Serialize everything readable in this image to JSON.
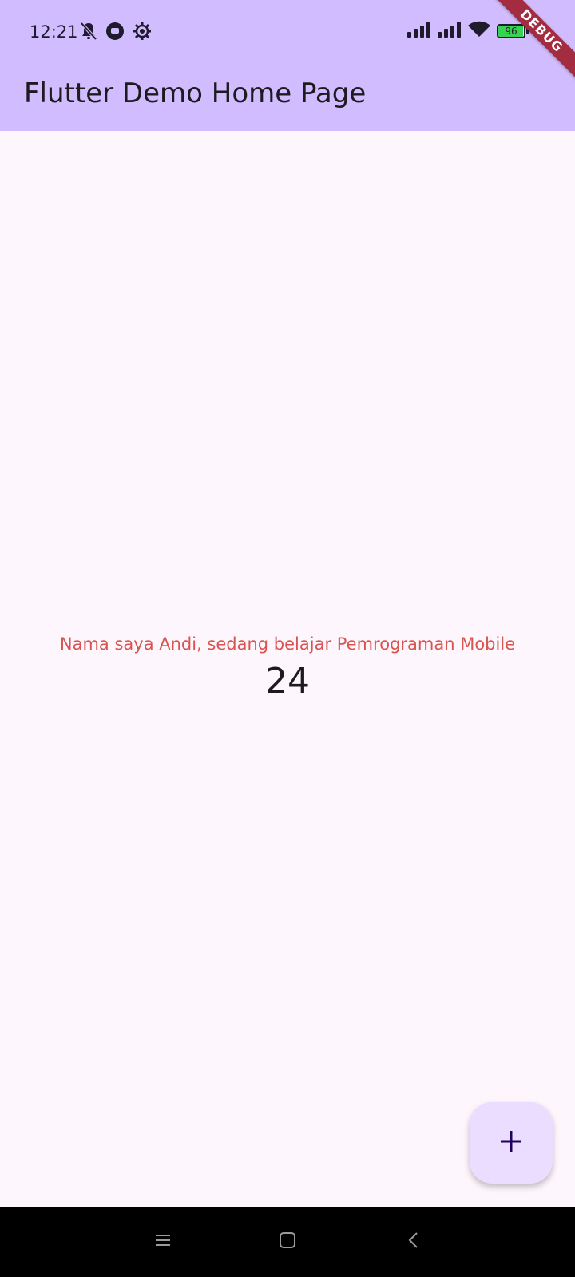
{
  "status_bar": {
    "time": "12:21",
    "battery_level": "96",
    "battery_fraction": 0.96,
    "icons": [
      "bell-off-icon",
      "messenger-icon",
      "gear-icon",
      "signal-icon",
      "signal-icon",
      "wifi-icon",
      "battery-icon"
    ]
  },
  "app_bar": {
    "title": "Flutter Demo Home Page",
    "background_color": "#d0bcff"
  },
  "debug_banner": {
    "label": "DEBUG"
  },
  "main": {
    "message": "Nama saya Andi, sedang belajar Pemrograman Mobile",
    "message_color": "#d9534f",
    "counter": "24"
  },
  "fab": {
    "icon": "plus-icon",
    "background_color": "#eaddff"
  },
  "nav_bar": {
    "icons": [
      "menu-icon",
      "home-icon",
      "back-icon"
    ]
  }
}
